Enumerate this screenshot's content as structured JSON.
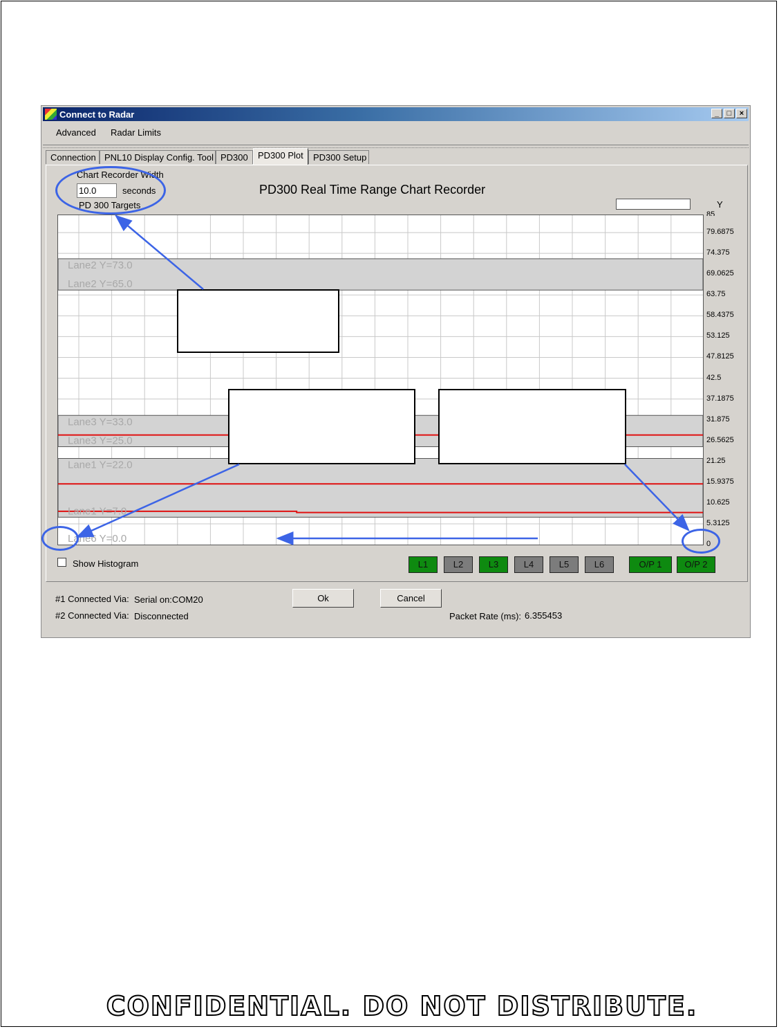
{
  "window": {
    "title": "Connect to Radar",
    "controls": [
      "_",
      "□",
      "×"
    ]
  },
  "menu": {
    "items": [
      "Advanced",
      "Radar Limits"
    ]
  },
  "tabs": [
    "Connection",
    "PNL10 Display Config. Tool",
    "PD300",
    "PD300 Plot",
    "PD300 Setup"
  ],
  "active_tab": "PD300 Plot",
  "recorder": {
    "width_label": "Chart Recorder Width",
    "width_value": "10.0",
    "unit_label": "seconds",
    "targets_label": "PD 300 Targets"
  },
  "chart_title": "PD300 Real Time Range Chart Recorder",
  "y_axis_label": "Y",
  "show_histogram_label": "Show Histogram",
  "show_histogram_checked": false,
  "lane_buttons": [
    {
      "label": "L1",
      "active": true
    },
    {
      "label": "L2",
      "active": false
    },
    {
      "label": "L3",
      "active": true
    },
    {
      "label": "L4",
      "active": false
    },
    {
      "label": "L5",
      "active": false
    },
    {
      "label": "L6",
      "active": false
    }
  ],
  "output_buttons": [
    {
      "label": "O/P 1",
      "active": true
    },
    {
      "label": "O/P 2",
      "active": true
    }
  ],
  "colors": {
    "active": "#0e8a10",
    "inactive": "#7c7c7c",
    "trace": "#e01010",
    "band": "#d3d3d3",
    "annotation": "#3c64e6"
  },
  "status": {
    "conn1_label": "#1 Connected Via:",
    "conn1_value": "Serial on:COM20",
    "conn2_label": "#2 Connected Via:",
    "conn2_value": "Disconnected",
    "packet_label": "Packet Rate (ms):",
    "packet_value": "6.355453"
  },
  "ok_label": "Ok",
  "cancel_label": "Cancel",
  "footer": "CONFIDENTIAL. DO NOT DISTRIBUTE.",
  "chart_data": {
    "type": "line",
    "title": "PD300 Real Time Range Chart Recorder",
    "ylabel": "Y",
    "ylim": [
      0,
      85
    ],
    "yticks": [
      "85",
      "79.6875",
      "74.375",
      "69.0625",
      "63.75",
      "58.4375",
      "53.125",
      "47.8125",
      "42.5",
      "37.1875",
      "31.875",
      "26.5625",
      "21.25",
      "15.9375",
      "10.625",
      "5.3125",
      "0"
    ],
    "grid": true,
    "lanes": [
      {
        "upper": 73.0,
        "lower": 65.0,
        "upper_label": "Lane2 Y=73.0",
        "lower_label": "Lane2 Y=65.0"
      },
      {
        "upper": 33.0,
        "lower": 25.0,
        "upper_label": "Lane3 Y=33.0",
        "lower_label": "Lane3 Y=25.0"
      },
      {
        "upper": 22.0,
        "lower": 7.0,
        "upper_label": "Lane1 Y=22.0",
        "lower_label": "Lane1 Y=7.0"
      },
      {
        "upper": 0.0,
        "lower": 0.0,
        "upper_label": "Lane6 Y=0.0",
        "lower_label": ""
      }
    ],
    "series": [
      {
        "x": [
          0,
          1
        ],
        "y": [
          28.0,
          28.0
        ]
      },
      {
        "x": [
          0,
          1
        ],
        "y": [
          15.5,
          15.5
        ]
      },
      {
        "x": [
          0,
          0.37,
          0.37,
          1
        ],
        "y": [
          8.5,
          8.5,
          8.2,
          8.2
        ]
      }
    ]
  }
}
